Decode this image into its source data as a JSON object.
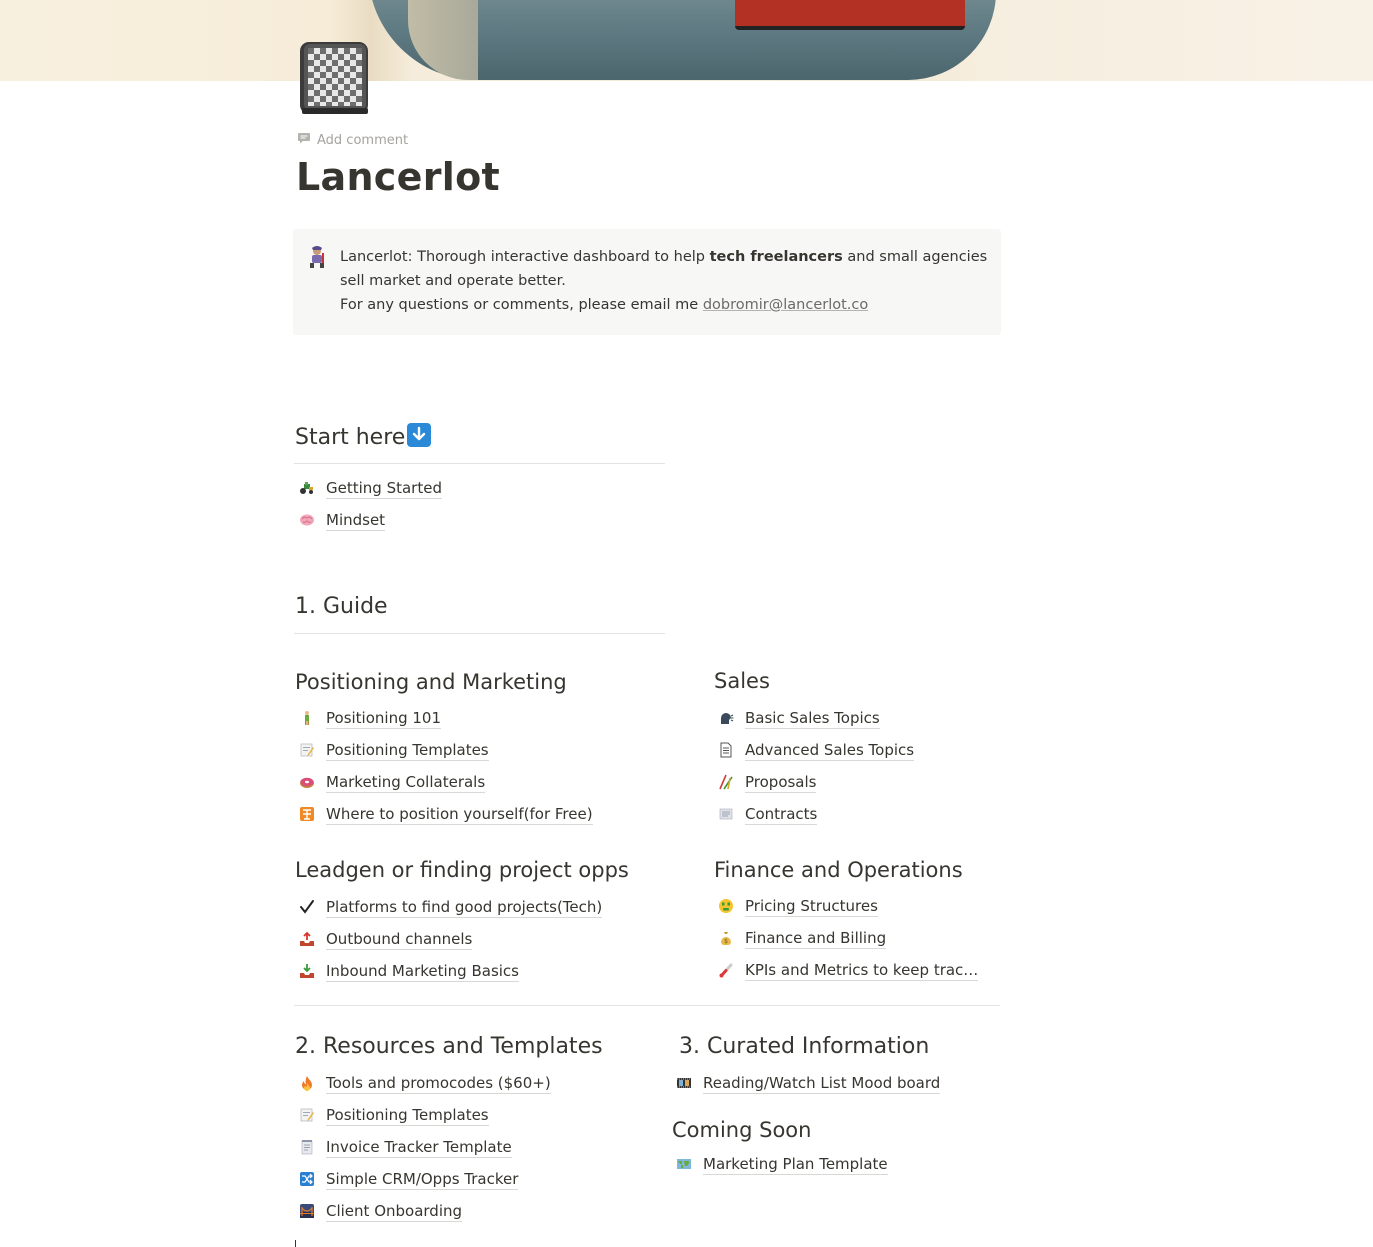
{
  "page": {
    "title": "Lancerlot",
    "add_comment": "Add comment"
  },
  "callout": {
    "line1_a": "Lancerlot: Thorough interactive dashboard to help ",
    "line1_bold": "tech freelancers",
    "line1_b": " and small agencies sell market and operate  better.",
    "line2_a": "For any questions or comments, please email me ",
    "email": "dobromir@lancerlot.co"
  },
  "start_here": {
    "heading": "Start here",
    "items": [
      {
        "label": "Getting Started",
        "icon": "tractor-icon"
      },
      {
        "label": "Mindset",
        "icon": "brain-icon"
      }
    ]
  },
  "guide": {
    "heading": "1. Guide",
    "positioning": {
      "heading": "Positioning and Marketing",
      "items": [
        {
          "label": "Positioning 101",
          "icon": "person-standing-icon"
        },
        {
          "label": "Positioning Templates",
          "icon": "memo-icon"
        },
        {
          "label": "Marketing Collaterals",
          "icon": "donut-icon"
        },
        {
          "label": "Where to position yourself(for Free)",
          "icon": "free-sign-icon"
        }
      ]
    },
    "sales": {
      "heading": "Sales",
      "items": [
        {
          "label": "Basic Sales Topics",
          "icon": "speaking-head-icon"
        },
        {
          "label": "Advanced Sales Topics",
          "icon": "document-icon"
        },
        {
          "label": "Proposals",
          "icon": "chopsticks-icon"
        },
        {
          "label": "Contracts",
          "icon": "receipt-icon"
        }
      ]
    },
    "leadgen": {
      "heading": "Leadgen or finding project opps",
      "items": [
        {
          "label": "Platforms to find good projects(Tech)",
          "icon": "check-mark-icon"
        },
        {
          "label": "Outbound channels",
          "icon": "outbox-tray-icon"
        },
        {
          "label": "Inbound Marketing Basics",
          "icon": "inbox-tray-icon"
        }
      ]
    },
    "finance": {
      "heading": "Finance and Operations",
      "items": [
        {
          "label": "Pricing Structures",
          "icon": "money-mouth-face-icon"
        },
        {
          "label": "Finance and Billing",
          "icon": "money-bag-icon"
        },
        {
          "label": "KPIs and Metrics to keep trac…",
          "icon": "thermometer-icon"
        }
      ]
    }
  },
  "resources": {
    "heading": "2. Resources and Templates",
    "items": [
      {
        "label": "Tools and promocodes ($60+)",
        "icon": "fire-icon"
      },
      {
        "label": "Positioning Templates",
        "icon": "memo-icon"
      },
      {
        "label": "Invoice Tracker Template",
        "icon": "notepad-icon"
      },
      {
        "label": "Simple CRM/Opps Tracker",
        "icon": "shuffle-icon"
      },
      {
        "label": "Client Onboarding",
        "icon": "bridge-icon"
      }
    ]
  },
  "curated": {
    "heading": "3. Curated Information",
    "items": [
      {
        "label": "Reading/Watch List Mood board",
        "icon": "film-frames-icon"
      }
    ]
  },
  "coming_soon": {
    "heading": "Coming Soon",
    "items": [
      {
        "label": "Marketing Plan Template",
        "icon": "world-map-icon"
      }
    ]
  },
  "colors": {
    "text": "#37352f",
    "callout_bg": "#f7f7f5",
    "arrow_box": "#2a8ad8",
    "muted": "#a5a39d"
  }
}
